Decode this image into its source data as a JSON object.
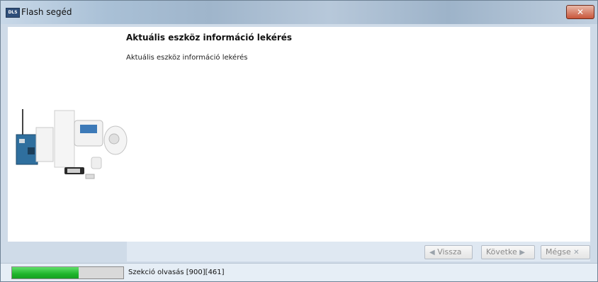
{
  "window": {
    "title": "Flash segéd",
    "app_icon_text": "DLS",
    "close_glyph": "✕"
  },
  "main": {
    "heading": "Aktuális eszköz információ lekérés",
    "subtext": "Aktuális eszköz információ lekérés"
  },
  "buttons": {
    "back_label": "Vissza",
    "back_icon": "arrow-left-icon",
    "next_label": "Követke",
    "next_icon": "arrow-right-icon",
    "cancel_label": "Mégse",
    "cancel_icon": "close-icon"
  },
  "status": {
    "text": "Szekció olvasás [900][461]",
    "progress_fraction": 0.6
  },
  "colors": {
    "progress_fill": "#20b52c",
    "disabled_text": "#8a8a8a"
  }
}
